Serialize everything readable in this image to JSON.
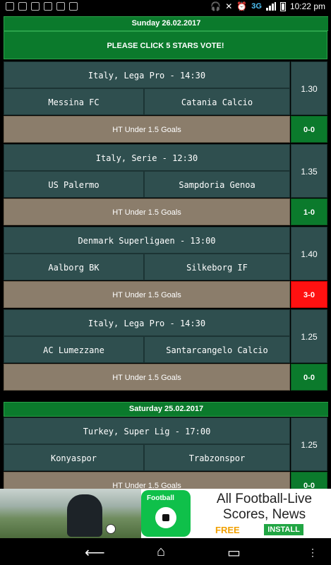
{
  "status": {
    "network": "3G",
    "time": "10:22 pm"
  },
  "sections": [
    {
      "date": "Sunday 26.02.2017",
      "vote": "PLEASE CLICK 5 STARS VOTE!",
      "matches": [
        {
          "league": "Italy, Lega Pro - 14:30",
          "home": "Messina FC",
          "away": "Catania Calcio",
          "odds": "1.30",
          "tip": "HT Under 1.5 Goals",
          "result": "0-0",
          "status": "win"
        },
        {
          "league": "Italy, Serie - 12:30",
          "home": "US Palermo",
          "away": "Sampdoria Genoa",
          "odds": "1.35",
          "tip": "HT Under 1.5 Goals",
          "result": "1-0",
          "status": "win"
        },
        {
          "league": "Denmark Superligaen - 13:00",
          "home": "Aalborg BK",
          "away": "Silkeborg IF",
          "odds": "1.40",
          "tip": "HT Under 1.5 Goals",
          "result": "3-0",
          "status": "loss"
        },
        {
          "league": "Italy, Lega Pro - 14:30",
          "home": "AC Lumezzane",
          "away": "Santarcangelo Calcio",
          "odds": "1.25",
          "tip": "HT Under 1.5 Goals",
          "result": "0-0",
          "status": "win"
        }
      ]
    },
    {
      "date": "Saturday 25.02.2017",
      "matches": [
        {
          "league": "Turkey, Super Lig - 17:00",
          "home": "Konyaspor",
          "away": "Trabzonspor",
          "odds": "1.25",
          "tip": "HT Under 1.5 Goals",
          "result": "0-0",
          "status": "win"
        }
      ]
    }
  ],
  "ad": {
    "app_label": "Football",
    "title": "All Football-Live Scores, News",
    "free": "FREE",
    "install": "INSTALL"
  },
  "colors": {
    "header_green": "#0b7a2c",
    "cell_teal": "#2f4f4f",
    "tip_tan": "#8b7d6b",
    "loss_red": "#ff1111"
  }
}
